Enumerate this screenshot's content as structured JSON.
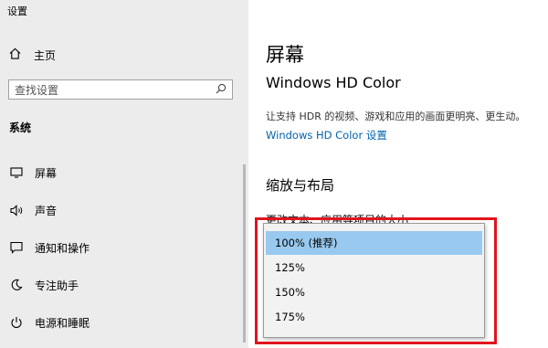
{
  "window": {
    "title": "设置"
  },
  "sidebar": {
    "home_label": "主页",
    "search_placeholder": "查找设置",
    "section_title": "系统",
    "items": [
      {
        "label": "屏幕",
        "icon": "monitor-icon"
      },
      {
        "label": "声音",
        "icon": "speaker-icon"
      },
      {
        "label": "通知和操作",
        "icon": "message-icon"
      },
      {
        "label": "专注助手",
        "icon": "moon-icon"
      },
      {
        "label": "电源和睡眠",
        "icon": "power-icon"
      }
    ]
  },
  "main": {
    "page_title": "屏幕",
    "hdr_title": "Windows HD Color",
    "hdr_desc": "让支持 HDR 的视频、游戏和应用的画面更明亮、更生动。",
    "hdr_link": "Windows HD Color 设置",
    "scale_title": "缩放与布局",
    "scale_label": "更改文本、应用等项目的大小",
    "scale_options": [
      "100% (推荐)",
      "125%",
      "150%",
      "175%"
    ],
    "selected_option": "100% (推荐)"
  },
  "colors": {
    "accent_link": "#0063b1",
    "selection": "#99c9ef",
    "highlight_box": "#e0141d",
    "sidebar_bg": "#ececec"
  }
}
